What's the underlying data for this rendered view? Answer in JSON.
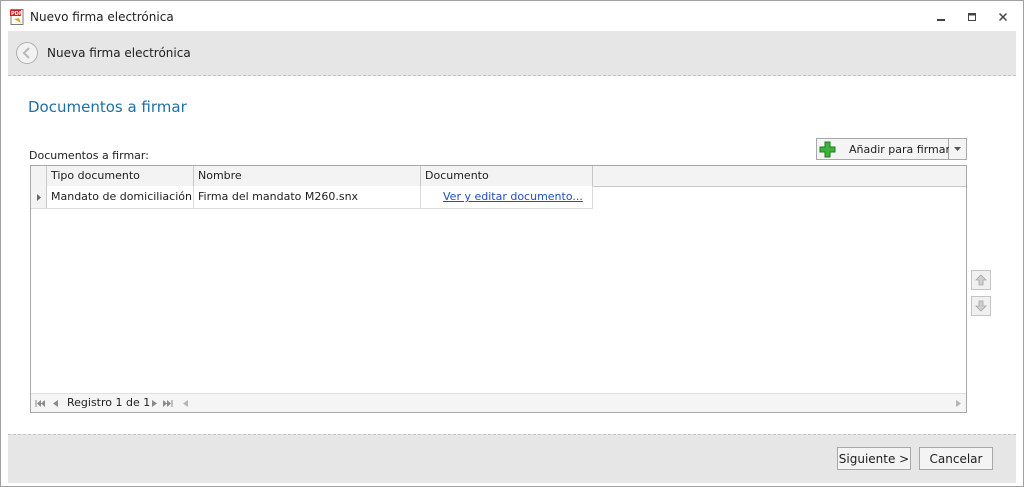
{
  "window": {
    "title": "Nuevo firma electrónica"
  },
  "header": {
    "title": "Nueva firma electrónica"
  },
  "main": {
    "section_title": "Documentos a firmar",
    "docs_label": "Documentos a firmar:",
    "add_button_label": "Añadir para firmar"
  },
  "grid": {
    "columns": [
      "Tipo documento",
      "Nombre",
      "Documento"
    ],
    "rows": [
      {
        "tipo": "Mandato de domiciliación",
        "nombre": "Firma del mandato M260.snx",
        "documento_link": "Ver y editar  documento..."
      }
    ],
    "record_text": "Registro 1 de 1"
  },
  "footer": {
    "next_label": "Siguiente >",
    "cancel_label": "Cancelar"
  },
  "colors": {
    "accent_title": "#1f6fa6",
    "link": "#1f4fbf",
    "band": "#e6e6e6",
    "add_icon": "#3cb43c"
  },
  "icons": {
    "app": "pdf-icon",
    "back": "back-arrow-icon",
    "add": "plus-icon",
    "move_up": "arrow-up-icon",
    "move_down": "arrow-down-icon"
  }
}
